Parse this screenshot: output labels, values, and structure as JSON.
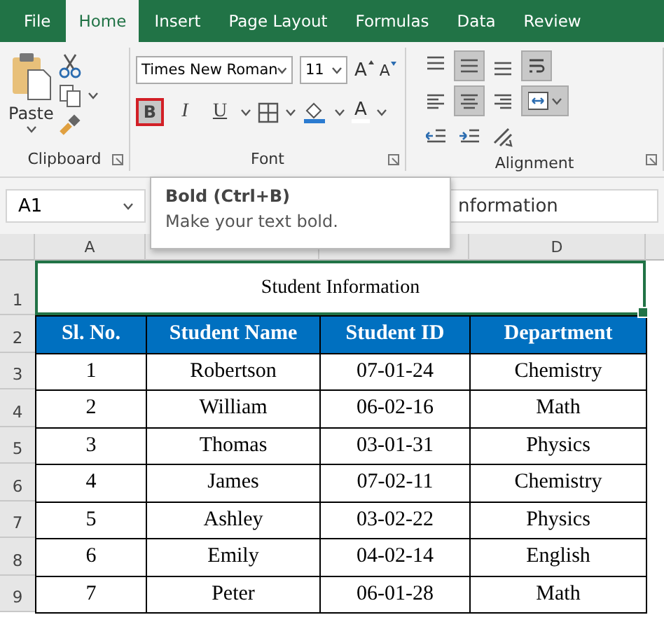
{
  "tabs": [
    {
      "label": "File",
      "selected": false
    },
    {
      "label": "Home",
      "selected": true
    },
    {
      "label": "Insert",
      "selected": false
    },
    {
      "label": "Page Layout",
      "selected": false
    },
    {
      "label": "Formulas",
      "selected": false
    },
    {
      "label": "Data",
      "selected": false
    },
    {
      "label": "Review",
      "selected": false
    }
  ],
  "ribbon": {
    "clipboard": {
      "paste_label": "Paste",
      "group_label": "Clipboard"
    },
    "font": {
      "font_name": "Times New Roman",
      "font_size": "11",
      "grow_label": "A",
      "shrink_label": "A",
      "bold": {
        "label": "B",
        "highlighted": true
      },
      "italic": {
        "label": "I",
        "highlighted": false
      },
      "underline": {
        "label": "U",
        "highlighted": false
      },
      "font_color_label": "A",
      "group_label": "Font"
    },
    "alignment": {
      "group_label": "Alignment",
      "buttons": [
        {
          "kind": "align-top",
          "selected": false
        },
        {
          "kind": "align-middle",
          "selected": true
        },
        {
          "kind": "align-bottom",
          "selected": false
        },
        {
          "kind": "wrap",
          "selected": true
        },
        {
          "kind": "align-left",
          "selected": false
        },
        {
          "kind": "align-center",
          "selected": true
        },
        {
          "kind": "align-right",
          "selected": false
        },
        {
          "kind": "merge",
          "selected": true
        },
        {
          "kind": "indent-decrease",
          "selected": false
        },
        {
          "kind": "indent-increase",
          "selected": false
        },
        {
          "kind": "orientation",
          "selected": false
        }
      ]
    }
  },
  "tooltip": {
    "title": "Bold (Ctrl+B)",
    "description": "Make your text bold."
  },
  "formula_bar": {
    "name_box": "A1",
    "formula": "nformation"
  },
  "sheet": {
    "columns": [
      {
        "label": "A"
      },
      {
        "covered": true
      },
      {
        "covered": true
      },
      {
        "label": "D"
      }
    ],
    "title_row": {
      "row": "1",
      "text": "Student Information"
    },
    "header_row": {
      "row": "2",
      "cells": [
        "Sl. No.",
        "Student Name",
        "Student ID",
        "Department"
      ]
    },
    "rows": [
      {
        "row": "3",
        "cells": [
          "1",
          "Robertson",
          "07-01-24",
          "Chemistry"
        ]
      },
      {
        "row": "4",
        "cells": [
          "2",
          "William",
          "06-02-16",
          "Math"
        ]
      },
      {
        "row": "5",
        "cells": [
          "3",
          "Thomas",
          "03-01-31",
          "Physics"
        ]
      },
      {
        "row": "6",
        "cells": [
          "4",
          "James",
          "07-02-11",
          "Chemistry"
        ]
      },
      {
        "row": "7",
        "cells": [
          "5",
          "Ashley",
          "03-02-22",
          "Physics"
        ]
      },
      {
        "row": "8",
        "cells": [
          "6",
          "Emily",
          "04-02-14",
          "English"
        ]
      },
      {
        "row": "9",
        "cells": [
          "7",
          "Peter",
          "06-01-28",
          "Math"
        ]
      }
    ]
  }
}
